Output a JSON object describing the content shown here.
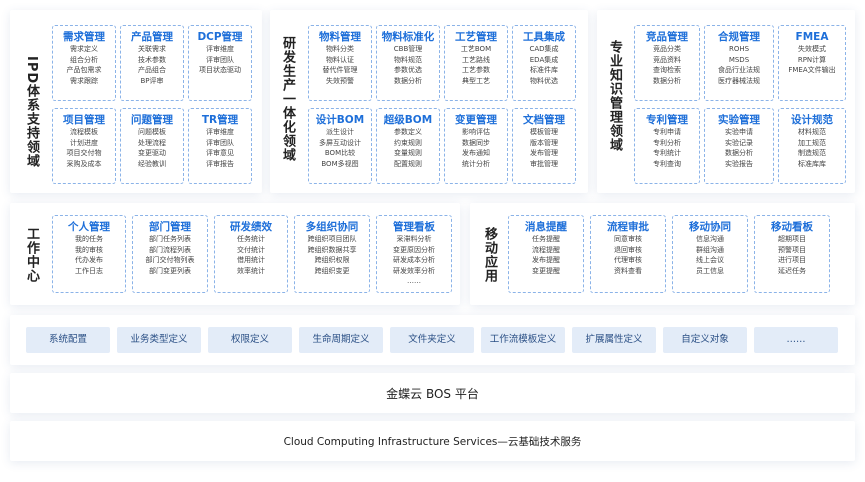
{
  "sections": {
    "ipd": {
      "label": "IPD体系支持领域",
      "cards": [
        {
          "title": "需求管理",
          "items": [
            "需求定义",
            "组合分析",
            "产品包需求",
            "需求跟踪"
          ]
        },
        {
          "title": "产品管理",
          "items": [
            "关联需求",
            "技术参数",
            "产品组合",
            "BP评审"
          ]
        },
        {
          "title": "DCP管理",
          "items": [
            "评审维度",
            "评审团队",
            "项目状态驱动"
          ]
        },
        {
          "title": "项目管理",
          "items": [
            "流程模板",
            "计划进度",
            "项目交付物",
            "采购及成本"
          ]
        },
        {
          "title": "问题管理",
          "items": [
            "问题模板",
            "处理流程",
            "变更驱动",
            "经验教训"
          ]
        },
        {
          "title": "TR管理",
          "items": [
            "评审维度",
            "评审团队",
            "评审意见",
            "评审报告"
          ]
        }
      ]
    },
    "rd": {
      "label": "研发生产一体化领域",
      "cards": [
        {
          "title": "物料管理",
          "items": [
            "物料分类",
            "物料认证",
            "替代件管理",
            "失效预警"
          ]
        },
        {
          "title": "物料标准化",
          "items": [
            "CBB管理",
            "物料规范",
            "参数优选",
            "数据分析"
          ]
        },
        {
          "title": "工艺管理",
          "items": [
            "工艺BOM",
            "工艺路线",
            "工艺参数",
            "典型工艺"
          ]
        },
        {
          "title": "工具集成",
          "items": [
            "CAD集成",
            "EDA集成",
            "标准件库",
            "物料优选"
          ]
        },
        {
          "title": "设计BOM",
          "items": [
            "派生设计",
            "多屏互动设计",
            "BOM比较",
            "BOM多视图"
          ]
        },
        {
          "title": "超级BOM",
          "items": [
            "参数定义",
            "约束规则",
            "变量规则",
            "配置规则"
          ]
        },
        {
          "title": "变更管理",
          "items": [
            "影响评估",
            "数据同步",
            "发布通知",
            "统计分析"
          ]
        },
        {
          "title": "文档管理",
          "items": [
            "模板管理",
            "版本管理",
            "发布管理",
            "审批管理"
          ]
        }
      ]
    },
    "knowledge": {
      "label": "专业知识管理领域",
      "cards": [
        {
          "title": "竞品管理",
          "items": [
            "竞品分类",
            "竞品资料",
            "查询检索",
            "数据分析"
          ]
        },
        {
          "title": "合规管理",
          "items": [
            "ROHS",
            "MSDS",
            "食品行业法规",
            "医疗器械法规"
          ]
        },
        {
          "title": "FMEA",
          "items": [
            "失效模式",
            "RPN计算",
            "FMEA文件输出"
          ]
        },
        {
          "title": "专利管理",
          "items": [
            "专利申请",
            "专利分析",
            "专利统计",
            "专利查询"
          ]
        },
        {
          "title": "实验管理",
          "items": [
            "实验申请",
            "实验记录",
            "数据分析",
            "实验报告"
          ]
        },
        {
          "title": "设计规范",
          "items": [
            "材料规范",
            "加工规范",
            "制造规范",
            "标准库库"
          ]
        }
      ]
    },
    "work": {
      "label": "工作中心",
      "cards": [
        {
          "title": "个人管理",
          "items": [
            "我的任务",
            "我的审核",
            "代办发布",
            "工作日志"
          ]
        },
        {
          "title": "部门管理",
          "items": [
            "部门任务列表",
            "部门流程列表",
            "部门交付物列表",
            "部门变更列表"
          ]
        },
        {
          "title": "研发绩效",
          "items": [
            "任务统计",
            "交付统计",
            "借用统计",
            "效率统计"
          ]
        },
        {
          "title": "多组织协同",
          "items": [
            "跨组织项目团队",
            "跨组织数据共享",
            "跨组织权限",
            "跨组织变更"
          ]
        },
        {
          "title": "管理看板",
          "items": [
            "采滞料分析",
            "变更原因分析",
            "研发成本分析",
            "研发效率分析",
            "……"
          ]
        }
      ]
    },
    "mobile": {
      "label": "移动应用",
      "cards": [
        {
          "title": "消息提醒",
          "items": [
            "任务提醒",
            "流程提醒",
            "发布提醒",
            "变更提醒"
          ]
        },
        {
          "title": "流程审批",
          "items": [
            "同意审核",
            "退回审核",
            "代理审核",
            "资料查看"
          ]
        },
        {
          "title": "移动协同",
          "items": [
            "信息沟通",
            "群组沟通",
            "线上会议",
            "员工信息"
          ]
        },
        {
          "title": "移动看板",
          "items": [
            "超期项目",
            "预警项目",
            "进行项目",
            "延迟任务"
          ]
        }
      ]
    }
  },
  "system_config": [
    "系统配置",
    "业务类型定义",
    "权限定义",
    "生命周期定义",
    "文件夹定义",
    "工作流模板定义",
    "扩展属性定义",
    "自定义对象",
    "……"
  ],
  "platform": "金蝶云 BOS 平台",
  "infrastructure": "Cloud Computing Infrastructure Services—云基础技术服务",
  "colors": {
    "accent": "#1e6fd9",
    "card_border": "#8bb3e8",
    "system_tile": "#e3ecf8"
  }
}
